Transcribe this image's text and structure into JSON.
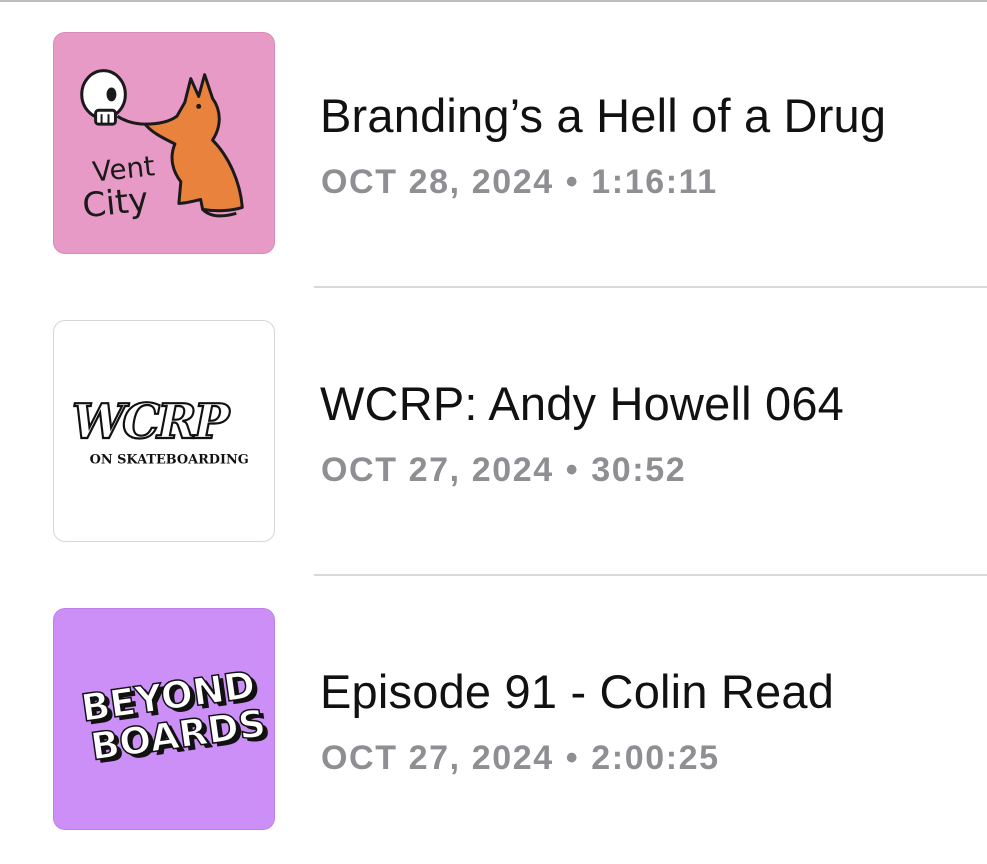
{
  "episodes": [
    {
      "title": "Branding’s a Hell of a Drug",
      "date": "OCT 28, 2024",
      "separator": "•",
      "duration": "1:16:11",
      "artwork": {
        "text_lines": [
          "Vent",
          "City"
        ],
        "background": "#e89ac6",
        "icon": "skull-and-dog-artwork"
      }
    },
    {
      "title": "WCRP: Andy Howell 064",
      "date": "OCT 27, 2024",
      "separator": "•",
      "duration": "30:52",
      "artwork": {
        "text_lines": [
          "WCRP",
          "ON SKATEBOARDING"
        ],
        "background": "#ffffff",
        "icon": "wcrp-logo-artwork"
      }
    },
    {
      "title": "Episode 91 - Colin Read",
      "date": "OCT 27, 2024",
      "separator": "•",
      "duration": "2:00:25",
      "artwork": {
        "text_lines": [
          "BEYOND",
          "BOARDS"
        ],
        "background": "#cc8ff7",
        "icon": "beyond-boards-logo-artwork"
      }
    }
  ],
  "colors": {
    "title": "#111111",
    "meta": "#8e8e93",
    "separator_line": "#d9d9d9"
  }
}
